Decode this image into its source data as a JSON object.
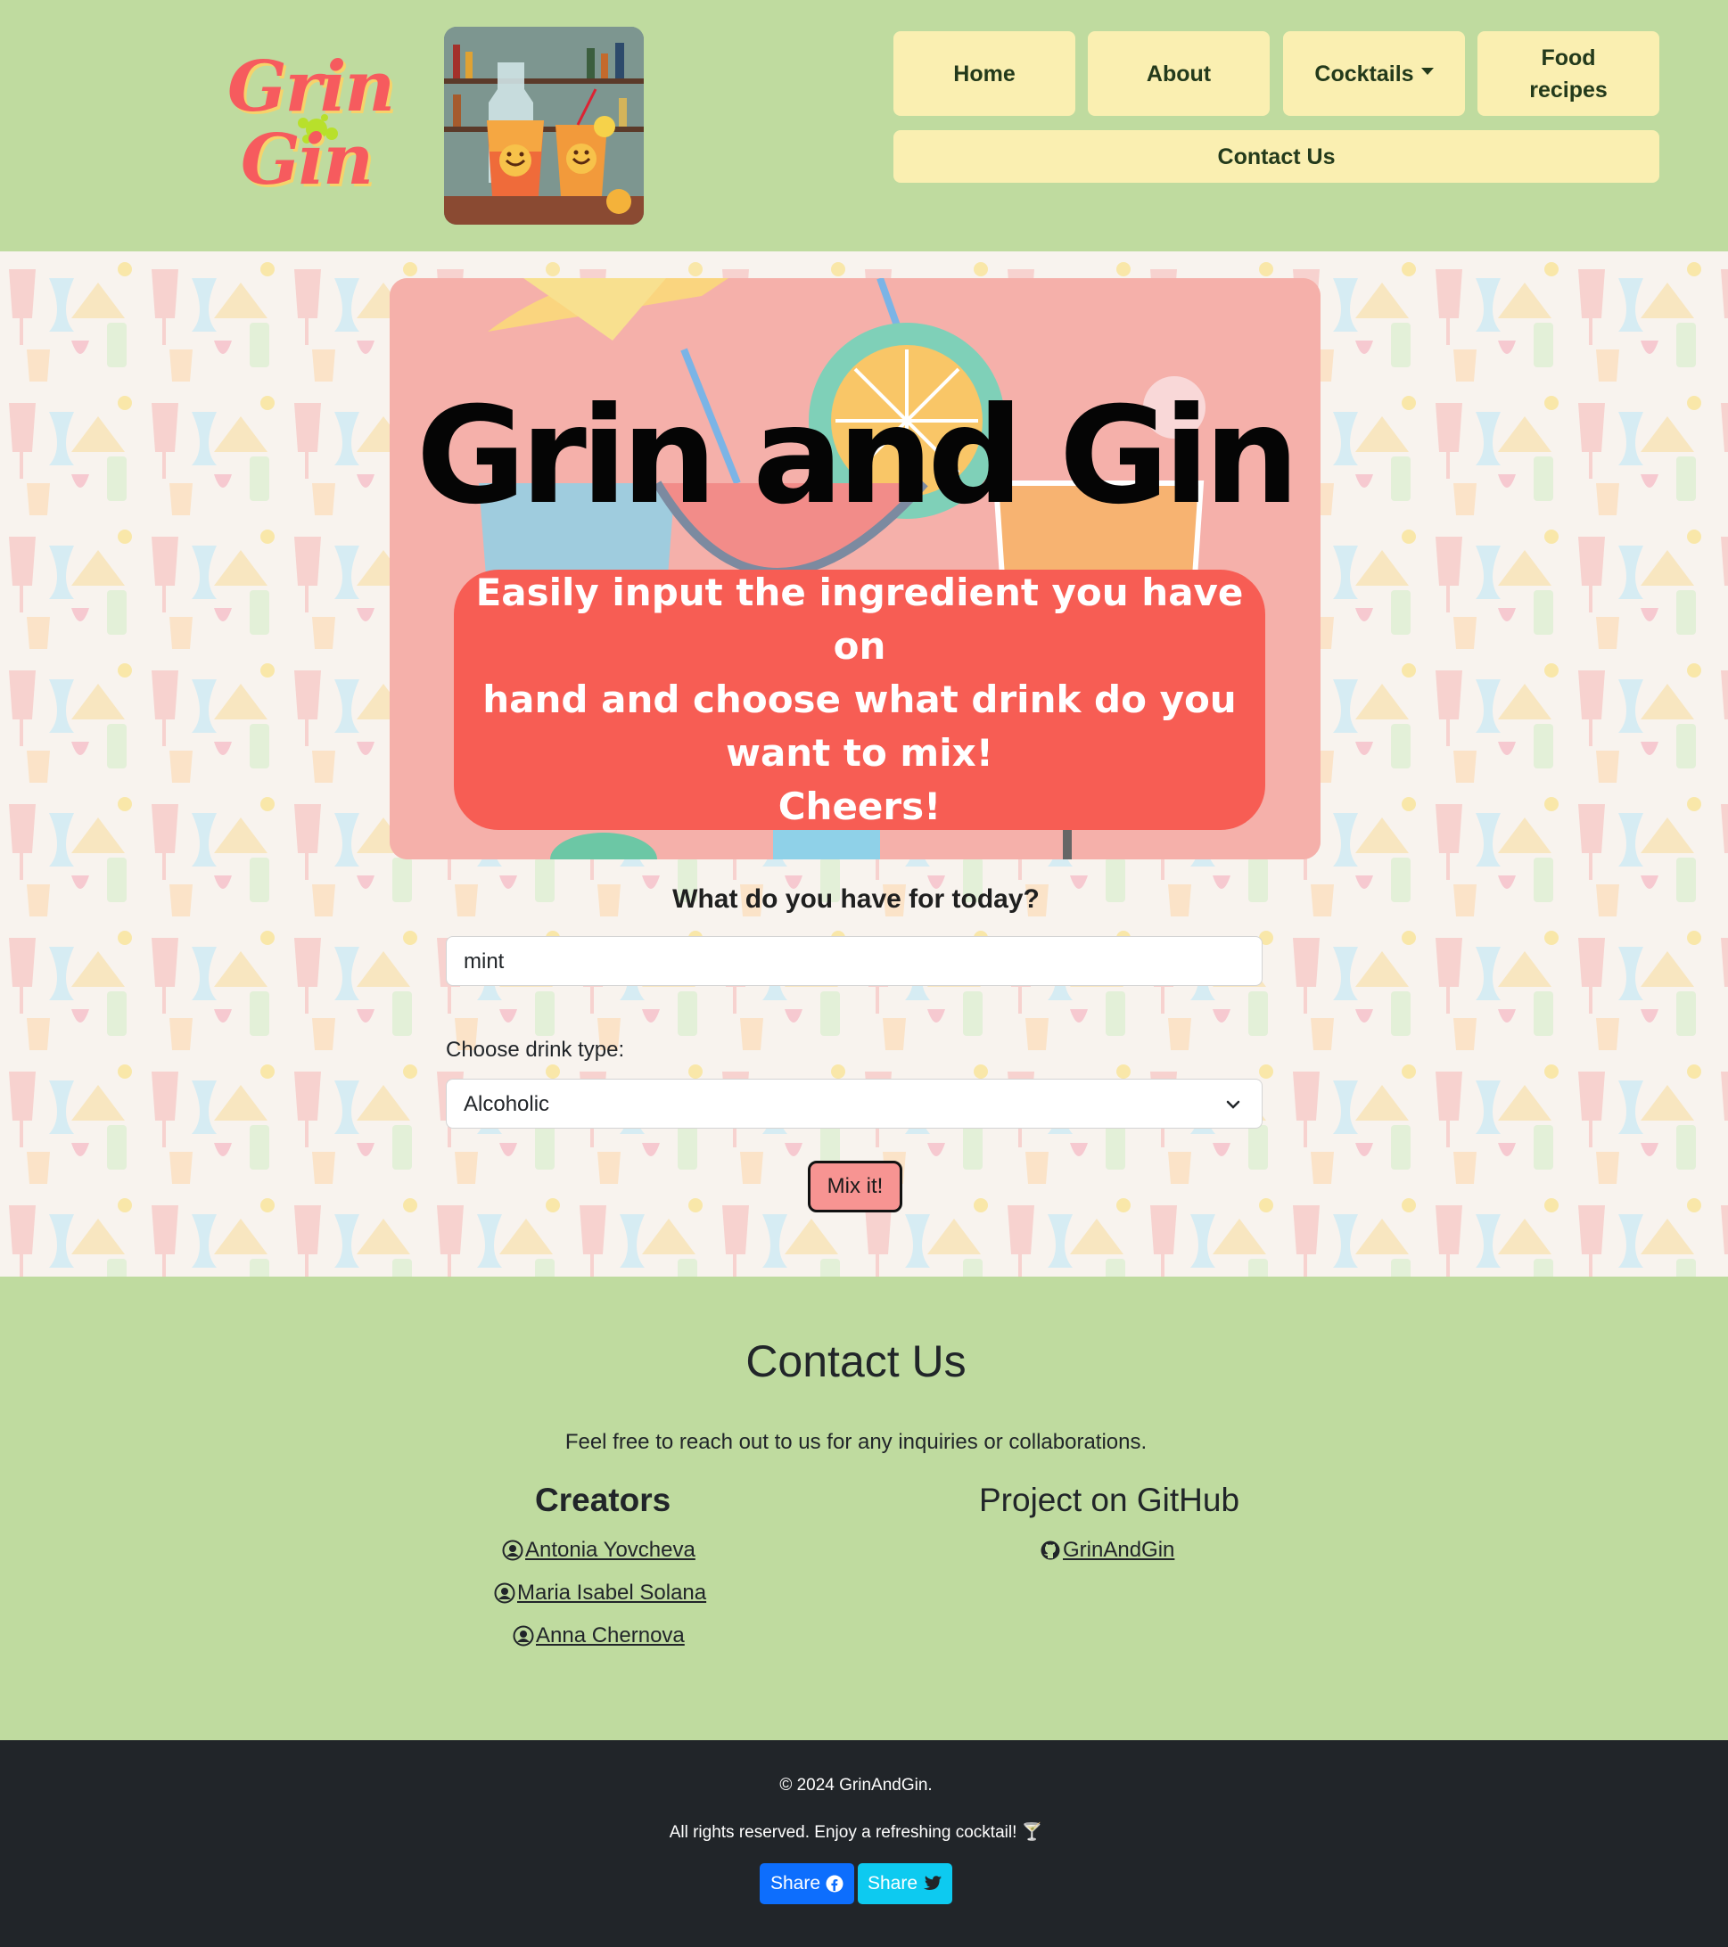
{
  "header": {
    "logo_line1": "Grin",
    "logo_line2": "Gin",
    "nav": {
      "home": "Home",
      "about": "About",
      "cocktails": "Cocktails",
      "food_recipes": "Food recipes",
      "contact": "Contact Us"
    }
  },
  "hero": {
    "title": "Grin and Gin",
    "line1": "Easily input the ingredient you have on",
    "line2": "hand and choose what drink do you",
    "line3": "want to mix!",
    "line4": "Cheers!"
  },
  "form": {
    "question": "What do you have for today?",
    "ingredient_value": "mint",
    "drink_type_label": "Choose drink type:",
    "drink_type_selected": "Alcoholic",
    "submit_label": "Mix it!"
  },
  "contact": {
    "title": "Contact Us",
    "intro": "Feel free to reach out to us for any inquiries or collaborations.",
    "creators_heading": "Creators",
    "creators": [
      "Antonia Yovcheva",
      "Maria Isabel Solana",
      "Anna Chernova"
    ],
    "github_heading": "Project on GitHub",
    "github_link": "GrinAndGin"
  },
  "footer": {
    "copyright": "© 2024 GrinAndGin.",
    "rights": "All rights reserved. Enjoy a refreshing cocktail! 🍸",
    "share_facebook": "Share",
    "share_twitter": "Share"
  },
  "colors": {
    "header_green": "#bfdb9f",
    "nav_yellow": "#faefb1",
    "hero_red": "#f75d54",
    "button_pink": "#f79492",
    "footer_dark": "#212529",
    "facebook_blue": "#0d6efd",
    "twitter_cyan": "#0dcaf0"
  }
}
